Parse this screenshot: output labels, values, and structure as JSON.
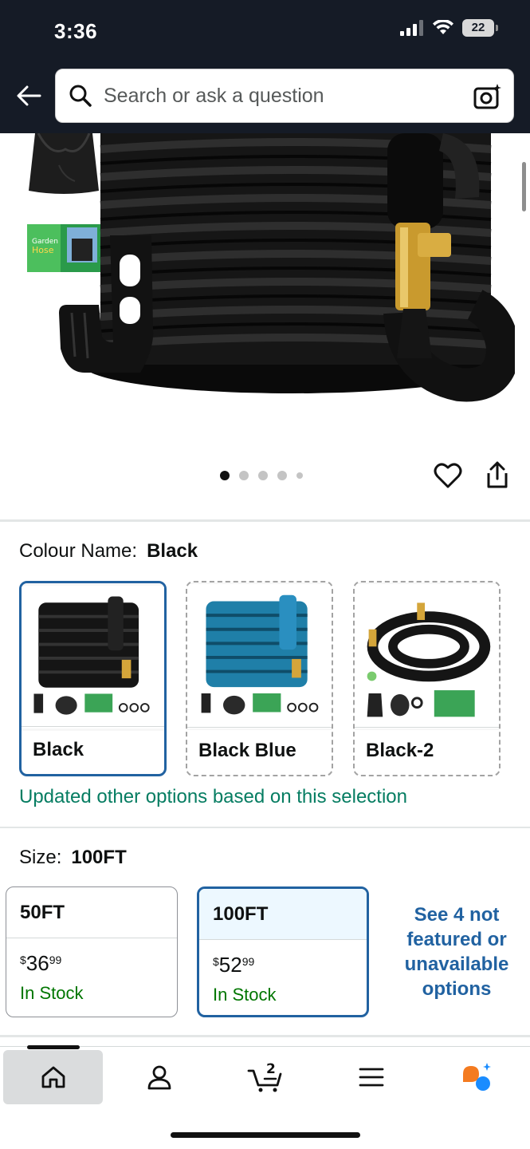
{
  "status_bar": {
    "time": "3:36",
    "battery": "22"
  },
  "header": {
    "search_placeholder": "Search or ask a question"
  },
  "gallery": {
    "dots_total": 5,
    "active_dot": 1
  },
  "colour": {
    "label": "Colour Name:",
    "selected": "Black",
    "options": [
      {
        "name": "Black"
      },
      {
        "name": "Black Blue"
      },
      {
        "name": "Black-2"
      }
    ],
    "note": "Updated other options based on this selection"
  },
  "size": {
    "label": "Size:",
    "selected": "100FT",
    "options": [
      {
        "name": "50FT",
        "currency": "$",
        "price_whole": "36",
        "price_fraction": "99",
        "stock": "In Stock"
      },
      {
        "name": "100FT",
        "currency": "$",
        "price_whole": "52",
        "price_fraction": "99",
        "stock": "In Stock"
      }
    ],
    "see_more": "See 4 not featured or unavailable options"
  },
  "bottom_nav": {
    "cart_count": "2",
    "items": [
      "home-icon",
      "account-icon",
      "cart-icon",
      "menu-icon",
      "rufus-icon"
    ]
  },
  "colors": {
    "header_bg": "#151b26",
    "selected_border": "#2162a1",
    "stock_green": "#007600",
    "note_green": "#067d62",
    "link_blue": "#2162a1"
  }
}
